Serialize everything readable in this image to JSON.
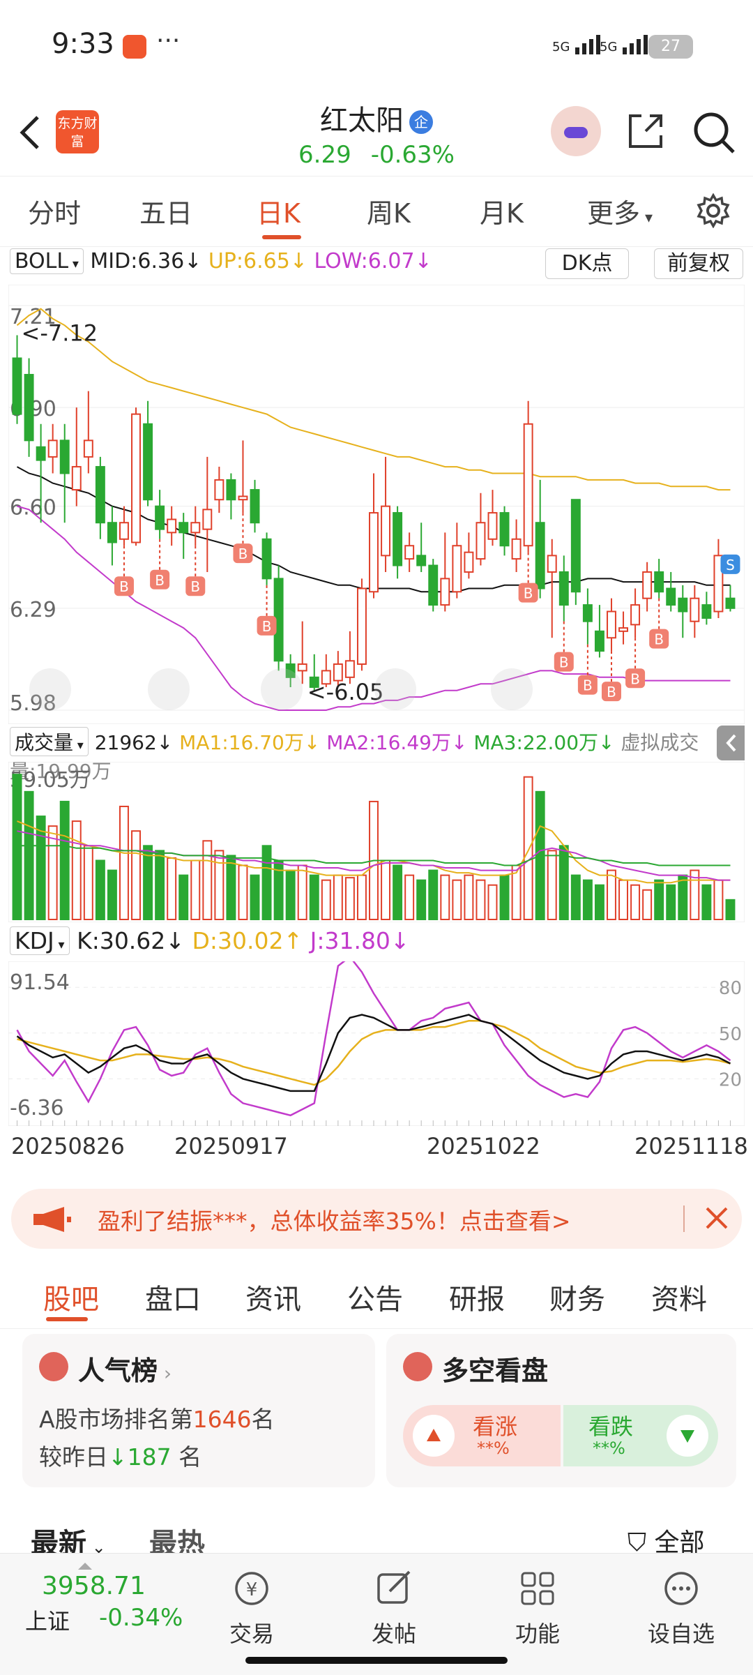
{
  "status": {
    "time": "9:33",
    "signal1": "5G",
    "signal2": "5G",
    "battery": "27"
  },
  "header": {
    "brand_logo_text": "东方财富",
    "stock_name": "红太阳",
    "badge": "企",
    "price": "6.29",
    "change_pct": "-0.63%"
  },
  "tabs": [
    "分时",
    "五日",
    "日K",
    "周K",
    "月K",
    "更多"
  ],
  "active_tab": "日K",
  "boll": {
    "name": "BOLL",
    "mid": "MID:6.36↓",
    "up": "UP:6.65↓",
    "low": "LOW:6.07↓"
  },
  "dk_button": "DK点",
  "fq_button": "前复权",
  "price_axis": [
    "7.21",
    "6.90",
    "6.60",
    "6.29",
    "5.98"
  ],
  "annotations": {
    "high": "<-7.12",
    "low": "<-6.05",
    "b_marker": "B",
    "s_marker": "S"
  },
  "volume": {
    "name": "成交量",
    "value": "21962↓",
    "ma1": "MA1:16.70万↓",
    "ma2": "MA2:16.49万↓",
    "ma3": "MA3:22.00万↓",
    "virtual": "虚拟成交量:19.99万",
    "max_label": "59.05万"
  },
  "kdj": {
    "name": "KDJ",
    "k": "K:30.62↓",
    "d": "D:30.02↑",
    "j": "J:31.80↓",
    "top": "91.54",
    "bottom": "-6.36",
    "levels": [
      "80",
      "50",
      "20"
    ]
  },
  "dates": [
    "20250826",
    "20250917",
    "20251022",
    "20251118"
  ],
  "promo": {
    "text": "盈利了结振***，总体收益率35%！点击查看>"
  },
  "subtabs": [
    "股吧",
    "盘口",
    "资讯",
    "公告",
    "研报",
    "财务",
    "资料"
  ],
  "popular": {
    "title": "人气榜",
    "line1_prefix": "A股市场排名第",
    "rank": "1646",
    "line1_suffix": "名",
    "line2_prefix": "较昨日",
    "change": "187",
    "line2_suffix": " 名"
  },
  "vote": {
    "title": "多空看盘",
    "up_label": "看涨",
    "up_pct": "**%",
    "down_label": "看跌",
    "down_pct": "**%"
  },
  "feed": {
    "tab1": "最新",
    "tab2": "最热",
    "filter": "全部"
  },
  "bottom": {
    "index_value": "3958.71",
    "index_name": "上证",
    "index_change": "-0.34%",
    "nav": [
      "交易",
      "发帖",
      "功能",
      "设自选"
    ]
  },
  "colors": {
    "up": "#e0402a",
    "down": "#2aa832",
    "mid": "#111111",
    "upper": "#e6b11c",
    "lower": "#c23acb",
    "accent": "#e0502a"
  },
  "chart_data": {
    "type": "candlestick",
    "price_ylim": [
      5.98,
      7.21
    ],
    "candles": [
      [
        7.05,
        6.88,
        7.12,
        6.85
      ],
      [
        7.0,
        6.8,
        7.05,
        6.75
      ],
      [
        6.78,
        6.74,
        6.85,
        6.55
      ],
      [
        6.75,
        6.8,
        6.85,
        6.7
      ],
      [
        6.8,
        6.7,
        6.85,
        6.55
      ],
      [
        6.65,
        6.72,
        6.9,
        6.6
      ],
      [
        6.75,
        6.8,
        6.95,
        6.7
      ],
      [
        6.72,
        6.55,
        6.75,
        6.5
      ],
      [
        6.55,
        6.49,
        6.6,
        6.42
      ],
      [
        6.5,
        6.55,
        6.6,
        6.48
      ],
      [
        6.49,
        6.88,
        6.9,
        6.48
      ],
      [
        6.85,
        6.62,
        6.92,
        6.6
      ],
      [
        6.6,
        6.53,
        6.65,
        6.5
      ],
      [
        6.52,
        6.56,
        6.6,
        6.48
      ],
      [
        6.55,
        6.52,
        6.58,
        6.44
      ],
      [
        6.52,
        6.55,
        6.6,
        6.48
      ],
      [
        6.53,
        6.59,
        6.75,
        6.4
      ],
      [
        6.62,
        6.68,
        6.72,
        6.58
      ],
      [
        6.68,
        6.62,
        6.7,
        6.56
      ],
      [
        6.62,
        6.63,
        6.8,
        6.58
      ],
      [
        6.65,
        6.55,
        6.68,
        6.52
      ],
      [
        6.5,
        6.38,
        6.52,
        6.36
      ],
      [
        6.38,
        6.13,
        6.42,
        6.1
      ],
      [
        6.12,
        6.08,
        6.15,
        6.05
      ],
      [
        6.1,
        6.12,
        6.25,
        6.06
      ],
      [
        6.08,
        6.05,
        6.15,
        6.04
      ],
      [
        6.06,
        6.1,
        6.15,
        6.05
      ],
      [
        6.07,
        6.12,
        6.16,
        6.05
      ],
      [
        6.08,
        6.13,
        6.22,
        6.06
      ],
      [
        6.12,
        6.35,
        6.38,
        6.1
      ],
      [
        6.34,
        6.58,
        6.7,
        6.32
      ],
      [
        6.45,
        6.6,
        6.75,
        6.4
      ],
      [
        6.58,
        6.42,
        6.6,
        6.38
      ],
      [
        6.44,
        6.48,
        6.52,
        6.4
      ],
      [
        6.45,
        6.42,
        6.55,
        6.4
      ],
      [
        6.42,
        6.3,
        6.44,
        6.28
      ],
      [
        6.3,
        6.38,
        6.52,
        6.28
      ],
      [
        6.34,
        6.48,
        6.55,
        6.32
      ],
      [
        6.4,
        6.46,
        6.52,
        6.38
      ],
      [
        6.44,
        6.55,
        6.64,
        6.42
      ],
      [
        6.5,
        6.58,
        6.65,
        6.48
      ],
      [
        6.58,
        6.48,
        6.6,
        6.45
      ],
      [
        6.44,
        6.5,
        6.56,
        6.4
      ],
      [
        6.48,
        6.85,
        6.92,
        6.46
      ],
      [
        6.55,
        6.35,
        6.68,
        6.32
      ],
      [
        6.4,
        6.45,
        6.5,
        6.2
      ],
      [
        6.4,
        6.3,
        6.45,
        6.25
      ],
      [
        6.62,
        6.34,
        6.62,
        6.3
      ],
      [
        6.3,
        6.25,
        6.35,
        6.18
      ],
      [
        6.22,
        6.16,
        6.3,
        6.14
      ],
      [
        6.2,
        6.28,
        6.32,
        6.16
      ],
      [
        6.22,
        6.23,
        6.28,
        6.18
      ],
      [
        6.24,
        6.3,
        6.35,
        6.2
      ],
      [
        6.32,
        6.4,
        6.43,
        6.28
      ],
      [
        6.4,
        6.34,
        6.44,
        6.32
      ],
      [
        6.35,
        6.3,
        6.4,
        6.28
      ],
      [
        6.32,
        6.28,
        6.36,
        6.2
      ],
      [
        6.25,
        6.32,
        6.36,
        6.2
      ],
      [
        6.3,
        6.26,
        6.34,
        6.24
      ],
      [
        6.28,
        6.45,
        6.5,
        6.26
      ],
      [
        6.32,
        6.29,
        6.36,
        6.28
      ]
    ],
    "mid": [
      6.72,
      6.7,
      6.69,
      6.67,
      6.66,
      6.65,
      6.64,
      6.62,
      6.6,
      6.59,
      6.58,
      6.56,
      6.55,
      6.54,
      6.52,
      6.51,
      6.5,
      6.49,
      6.48,
      6.47,
      6.45,
      6.43,
      6.42,
      6.4,
      6.39,
      6.38,
      6.37,
      6.36,
      6.36,
      6.35,
      6.35,
      6.35,
      6.35,
      6.35,
      6.34,
      6.34,
      6.34,
      6.34,
      6.35,
      6.35,
      6.35,
      6.36,
      6.36,
      6.36,
      6.36,
      6.37,
      6.37,
      6.37,
      6.38,
      6.38,
      6.38,
      6.37,
      6.37,
      6.37,
      6.37,
      6.37,
      6.37,
      6.37,
      6.36,
      6.36,
      6.36
    ],
    "upper": [
      7.15,
      7.18,
      7.2,
      7.17,
      7.15,
      7.12,
      7.1,
      7.07,
      7.04,
      7.02,
      7.0,
      6.98,
      6.97,
      6.96,
      6.95,
      6.94,
      6.93,
      6.92,
      6.91,
      6.9,
      6.89,
      6.88,
      6.86,
      6.84,
      6.83,
      6.82,
      6.81,
      6.8,
      6.79,
      6.78,
      6.77,
      6.76,
      6.75,
      6.75,
      6.74,
      6.73,
      6.72,
      6.72,
      6.71,
      6.71,
      6.7,
      6.7,
      6.7,
      6.7,
      6.69,
      6.69,
      6.69,
      6.69,
      6.68,
      6.68,
      6.68,
      6.68,
      6.67,
      6.67,
      6.67,
      6.66,
      6.66,
      6.66,
      6.66,
      6.65,
      6.65
    ],
    "lower": [
      6.6,
      6.59,
      6.56,
      6.53,
      6.5,
      6.46,
      6.43,
      6.4,
      6.37,
      6.34,
      6.31,
      6.29,
      6.27,
      6.25,
      6.23,
      6.2,
      6.15,
      6.1,
      6.05,
      6.02,
      6.0,
      5.99,
      5.98,
      5.98,
      5.98,
      5.98,
      5.98,
      5.99,
      5.99,
      6.0,
      6.0,
      6.01,
      6.01,
      6.02,
      6.02,
      6.03,
      6.04,
      6.04,
      6.05,
      6.06,
      6.06,
      6.07,
      6.08,
      6.09,
      6.1,
      6.1,
      6.09,
      6.09,
      6.09,
      6.08,
      6.08,
      6.08,
      6.07,
      6.07,
      6.07,
      6.07,
      6.07,
      6.07,
      6.07,
      6.07,
      6.07
    ],
    "buy_points": [
      9,
      12,
      15,
      19,
      21,
      43,
      46,
      48,
      50,
      52,
      54
    ],
    "sell_points": [
      60
    ],
    "volume_max": 59.05,
    "volume": [
      59,
      52,
      42,
      38,
      48,
      40,
      30,
      24,
      20,
      46,
      36,
      30,
      28,
      25,
      18,
      24,
      32,
      28,
      26,
      22,
      18,
      30,
      24,
      20,
      22,
      18,
      16,
      18,
      17,
      18,
      48,
      24,
      22,
      18,
      16,
      20,
      18,
      16,
      18,
      16,
      14,
      18,
      22,
      58,
      52,
      28,
      30,
      18,
      16,
      14,
      20,
      16,
      14,
      12,
      16,
      14,
      18,
      20,
      14,
      16,
      8
    ],
    "ma1": [
      40,
      38,
      36,
      35,
      34,
      32,
      30,
      29,
      28,
      27,
      27,
      26,
      26,
      25,
      24,
      24,
      24,
      23,
      23,
      22,
      21,
      21,
      20,
      20,
      20,
      19,
      18,
      18,
      18,
      18,
      22,
      24,
      24,
      23,
      22,
      22,
      20,
      19,
      19,
      18,
      18,
      18,
      19,
      28,
      38,
      36,
      30,
      24,
      20,
      18,
      18,
      16,
      16,
      15,
      15,
      15,
      16,
      16,
      16,
      16,
      16
    ],
    "ma2": [
      36,
      35,
      34,
      33,
      32,
      31,
      30,
      30,
      29,
      28,
      28,
      28,
      27,
      27,
      26,
      26,
      26,
      25,
      25,
      24,
      24,
      23,
      23,
      22,
      22,
      21,
      21,
      21,
      20,
      20,
      22,
      23,
      23,
      23,
      22,
      22,
      21,
      21,
      21,
      20,
      20,
      20,
      20,
      24,
      28,
      29,
      28,
      27,
      25,
      24,
      22,
      21,
      20,
      19,
      18,
      18,
      18,
      17,
      17,
      16,
      16
    ],
    "ma3": [
      30,
      30,
      30,
      30,
      30,
      29,
      29,
      29,
      28,
      28,
      28,
      27,
      27,
      27,
      26,
      26,
      26,
      26,
      25,
      25,
      25,
      25,
      24,
      24,
      24,
      24,
      23,
      23,
      23,
      23,
      24,
      24,
      24,
      24,
      24,
      24,
      23,
      23,
      23,
      23,
      23,
      22,
      22,
      24,
      26,
      26,
      26,
      25,
      25,
      24,
      24,
      23,
      23,
      23,
      22,
      22,
      22,
      22,
      22,
      22,
      22
    ],
    "kdj_ylim": [
      -6.36,
      91.54
    ],
    "k": [
      48,
      42,
      38,
      34,
      36,
      30,
      24,
      28,
      34,
      40,
      42,
      38,
      32,
      30,
      30,
      34,
      36,
      30,
      24,
      20,
      18,
      16,
      14,
      12,
      12,
      12,
      30,
      50,
      60,
      62,
      60,
      56,
      52,
      52,
      54,
      56,
      58,
      60,
      62,
      58,
      56,
      50,
      44,
      38,
      32,
      28,
      24,
      22,
      20,
      22,
      30,
      36,
      38,
      38,
      36,
      34,
      32,
      34,
      36,
      34,
      30
    ],
    "d": [
      46,
      44,
      42,
      40,
      38,
      36,
      34,
      32,
      32,
      34,
      36,
      36,
      35,
      34,
      33,
      33,
      34,
      33,
      31,
      28,
      26,
      24,
      22,
      20,
      18,
      16,
      20,
      28,
      38,
      46,
      50,
      52,
      52,
      52,
      52,
      54,
      54,
      56,
      58,
      58,
      56,
      54,
      50,
      46,
      40,
      36,
      32,
      28,
      26,
      24,
      25,
      28,
      30,
      32,
      32,
      32,
      31,
      32,
      33,
      32,
      30
    ],
    "j": [
      52,
      38,
      30,
      22,
      32,
      18,
      5,
      20,
      38,
      52,
      54,
      42,
      26,
      22,
      24,
      36,
      40,
      24,
      10,
      4,
      2,
      0,
      -2,
      -4,
      0,
      4,
      50,
      94,
      100,
      90,
      76,
      64,
      52,
      52,
      58,
      60,
      66,
      68,
      70,
      58,
      56,
      42,
      32,
      22,
      16,
      12,
      8,
      10,
      8,
      18,
      40,
      52,
      54,
      50,
      44,
      38,
      34,
      38,
      42,
      38,
      32
    ]
  }
}
